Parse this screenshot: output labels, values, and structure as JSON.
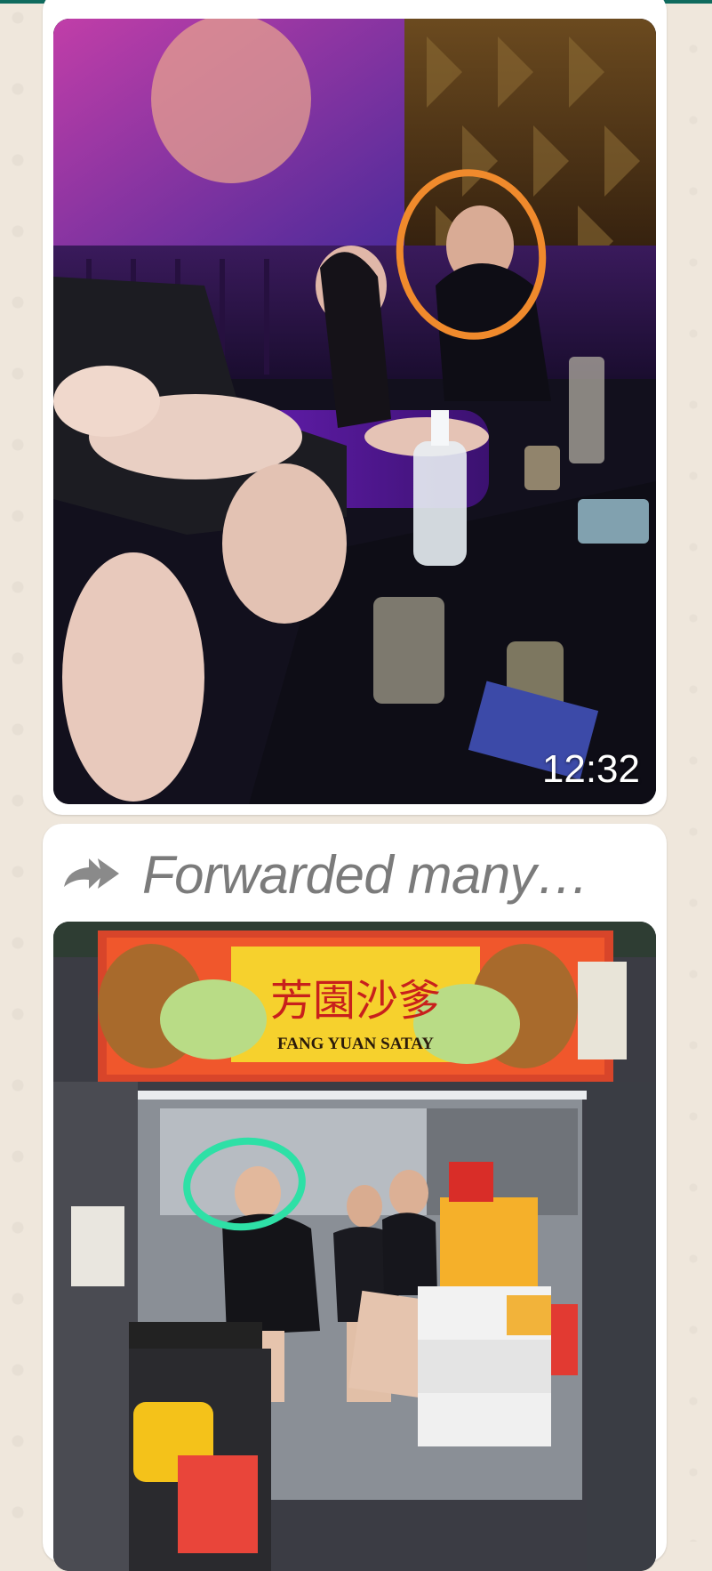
{
  "messages": [
    {
      "type": "video",
      "timestamp": "12:32",
      "accent_circle_color": "#f08a2c"
    },
    {
      "type": "image",
      "forwarded_label": "Forwarded many…",
      "stall_sign_chinese": "芳園沙爹",
      "stall_sign_english": "FANG YUAN SATAY",
      "accent_circle_color": "#2ee0a6"
    }
  ],
  "icons": {
    "forwarded": "double-forward-arrow-icon"
  }
}
